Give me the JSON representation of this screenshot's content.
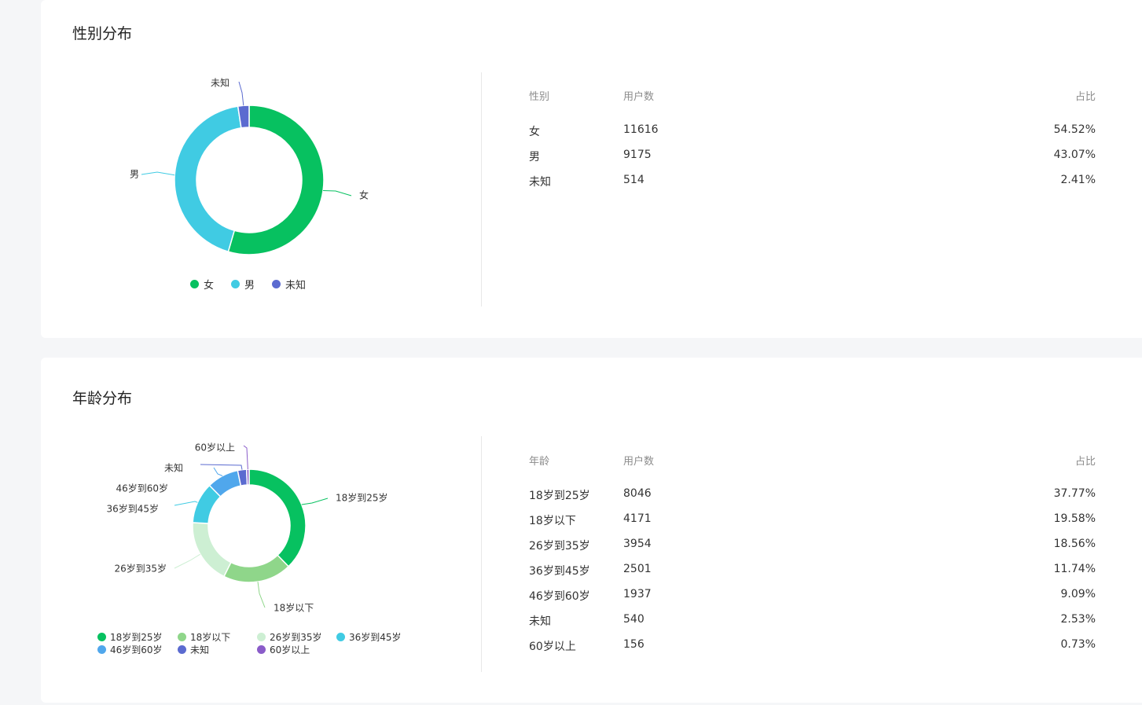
{
  "gender": {
    "title": "性别分布",
    "table": {
      "headers": [
        "性别",
        "用户数",
        "占比"
      ],
      "rows": [
        {
          "label": "女",
          "count": "11616",
          "pct": "54.52%"
        },
        {
          "label": "男",
          "count": "9175",
          "pct": "43.07%"
        },
        {
          "label": "未知",
          "count": "514",
          "pct": "2.41%"
        }
      ]
    },
    "legend": [
      "女",
      "男",
      "未知"
    ]
  },
  "age": {
    "title": "年龄分布",
    "table": {
      "headers": [
        "年龄",
        "用户数",
        "占比"
      ],
      "rows": [
        {
          "label": "18岁到25岁",
          "count": "8046",
          "pct": "37.77%"
        },
        {
          "label": "18岁以下",
          "count": "4171",
          "pct": "19.58%"
        },
        {
          "label": "26岁到35岁",
          "count": "3954",
          "pct": "18.56%"
        },
        {
          "label": "36岁到45岁",
          "count": "2501",
          "pct": "11.74%"
        },
        {
          "label": "46岁到60岁",
          "count": "1937",
          "pct": "9.09%"
        },
        {
          "label": "未知",
          "count": "540",
          "pct": "2.53%"
        },
        {
          "label": "60岁以上",
          "count": "156",
          "pct": "0.73%"
        }
      ]
    },
    "legend": [
      "18岁到25岁",
      "18岁以下",
      "26岁到35岁",
      "36岁到45岁",
      "46岁到60岁",
      "未知",
      "60岁以上"
    ]
  },
  "chart_data": [
    {
      "type": "pie",
      "title": "性别分布",
      "categories": [
        "女",
        "男",
        "未知"
      ],
      "values": [
        11616,
        9175,
        514
      ],
      "colors": [
        "#07c160",
        "#40cbe3",
        "#5b6bd0"
      ],
      "donut": true,
      "legend_position": "bottom"
    },
    {
      "type": "pie",
      "title": "年龄分布",
      "categories": [
        "18岁到25岁",
        "18岁以下",
        "26岁到35岁",
        "36岁到45岁",
        "46岁到60岁",
        "未知",
        "60岁以上"
      ],
      "values": [
        8046,
        4171,
        3954,
        2501,
        1937,
        540,
        156
      ],
      "colors": [
        "#07c160",
        "#8fd68a",
        "#cdefd3",
        "#40cbe3",
        "#50a7ec",
        "#5b6bd0",
        "#8a5cc9"
      ],
      "donut": true,
      "legend_position": "bottom"
    }
  ]
}
